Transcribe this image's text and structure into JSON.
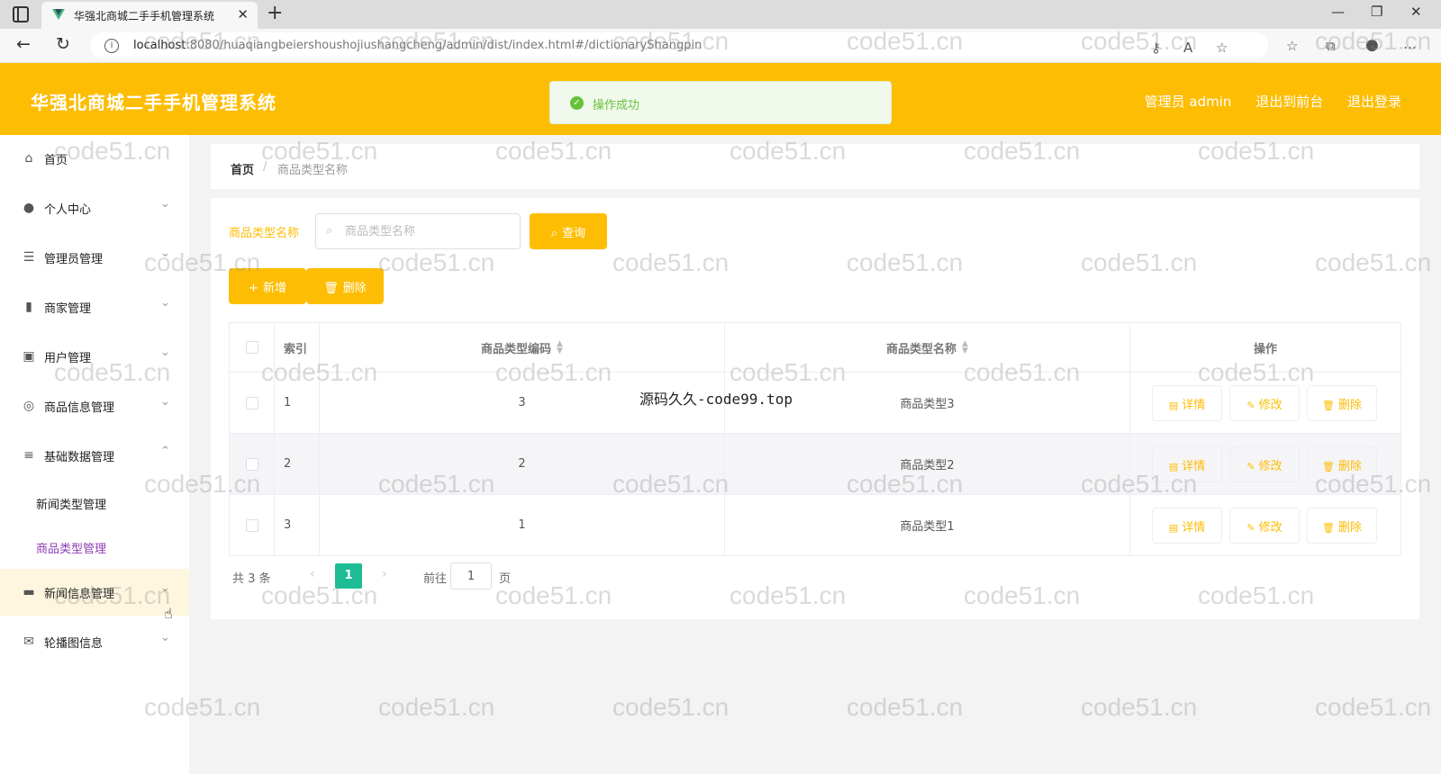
{
  "browser": {
    "tab_title": "华强北商城二手手机管理系统",
    "tab_close": "✕",
    "new_tab": "+",
    "url_host": "localhost",
    "url_rest": ":8080/huaqiangbeiershoushojiushangcheng/admin/dist/index.html#/dictionaryShangpin",
    "win_min": "—",
    "win_max": "❐",
    "win_close": "✕"
  },
  "header": {
    "title": "华强北商城二手手机管理系统",
    "user": "管理员 admin",
    "to_front": "退出到前台",
    "logout": "退出登录"
  },
  "toast": {
    "text": "操作成功"
  },
  "sidebar": {
    "items": [
      {
        "label": "首页"
      },
      {
        "label": "个人中心"
      },
      {
        "label": "管理员管理"
      },
      {
        "label": "商家管理"
      },
      {
        "label": "用户管理"
      },
      {
        "label": "商品信息管理"
      },
      {
        "label": "基础数据管理"
      },
      {
        "label": "新闻信息管理"
      },
      {
        "label": "轮播图信息"
      }
    ],
    "submenu": [
      {
        "label": "新闻类型管理"
      },
      {
        "label": "商品类型管理"
      }
    ]
  },
  "breadcrumb": {
    "home": "首页",
    "sep": "/",
    "current": "商品类型名称"
  },
  "search": {
    "label": "商品类型名称",
    "placeholder": "商品类型名称",
    "button": "查询"
  },
  "actions": {
    "add": "新增",
    "delete": "删除"
  },
  "table": {
    "headers": {
      "index": "索引",
      "code": "商品类型编码",
      "name": "商品类型名称",
      "ops": "操作"
    },
    "rows": [
      {
        "index": "1",
        "code": "3",
        "name": "商品类型3"
      },
      {
        "index": "2",
        "code": "2",
        "name": "商品类型2"
      },
      {
        "index": "3",
        "code": "1",
        "name": "商品类型1"
      }
    ],
    "op_labels": {
      "detail": "详情",
      "edit": "修改",
      "delete": "删除"
    }
  },
  "pager": {
    "total": "共 3 条",
    "current": "1",
    "goto": "前往",
    "page_input": "1",
    "page_suffix": "页",
    "prev": "‹",
    "next": "›"
  },
  "caption": "源码久久-code99.top",
  "watermark_text": "code51.cn",
  "colors": {
    "brand": "#fdbd03",
    "success": "#67c23a",
    "pager_active": "#1ebc94",
    "submenu_active": "#8e3db6"
  }
}
